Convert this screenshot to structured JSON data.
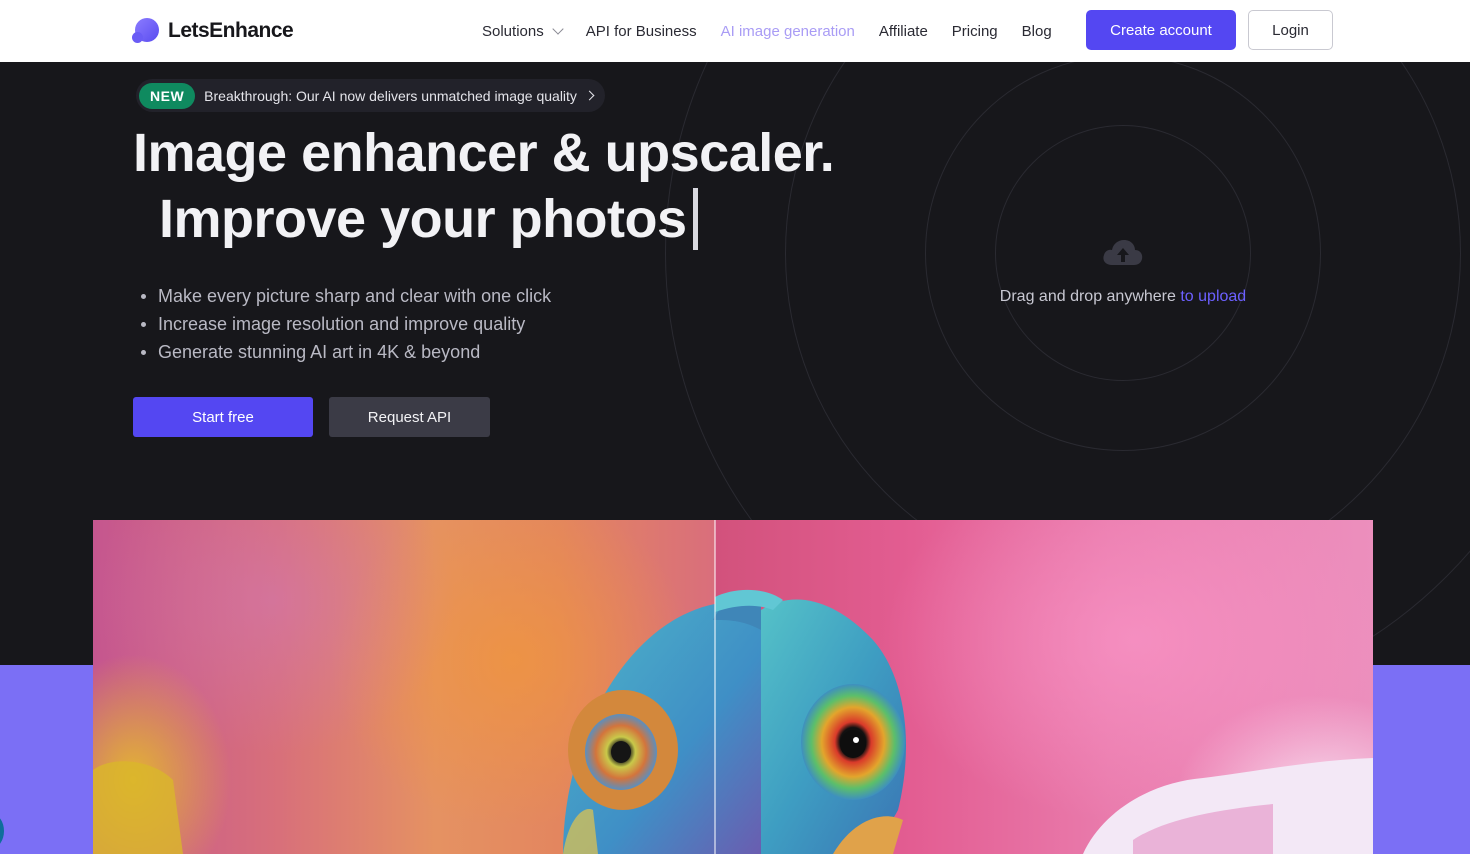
{
  "brand": {
    "name": "LetsEnhance"
  },
  "nav": {
    "items": [
      {
        "label": "Solutions",
        "has_dropdown": true
      },
      {
        "label": "API for Business"
      },
      {
        "label": "AI image generation",
        "active": true
      },
      {
        "label": "Affiliate"
      },
      {
        "label": "Pricing"
      },
      {
        "label": "Blog"
      }
    ],
    "create_account": "Create account",
    "login": "Login"
  },
  "hero": {
    "badge": "NEW",
    "announcement": "Breakthrough: Our AI now delivers unmatched image quality",
    "headline": "Image enhancer & upscaler.",
    "subheadline": "Improve your photos",
    "bullets": [
      "Make every picture sharp and clear with one click",
      "Increase image resolution and improve quality",
      "Generate stunning AI art in 4K & beyond"
    ],
    "start_free": "Start free",
    "request_api": "Request API"
  },
  "upload": {
    "text": "Drag and drop anywhere",
    "link": "to upload",
    "icon": "cloud-upload-icon"
  },
  "colors": {
    "accent": "#5447f2",
    "badge_green": "#0f8a5f",
    "hero_bg": "#17171b",
    "band": "#7b6ff5",
    "active_nav": "#a99cf5"
  }
}
